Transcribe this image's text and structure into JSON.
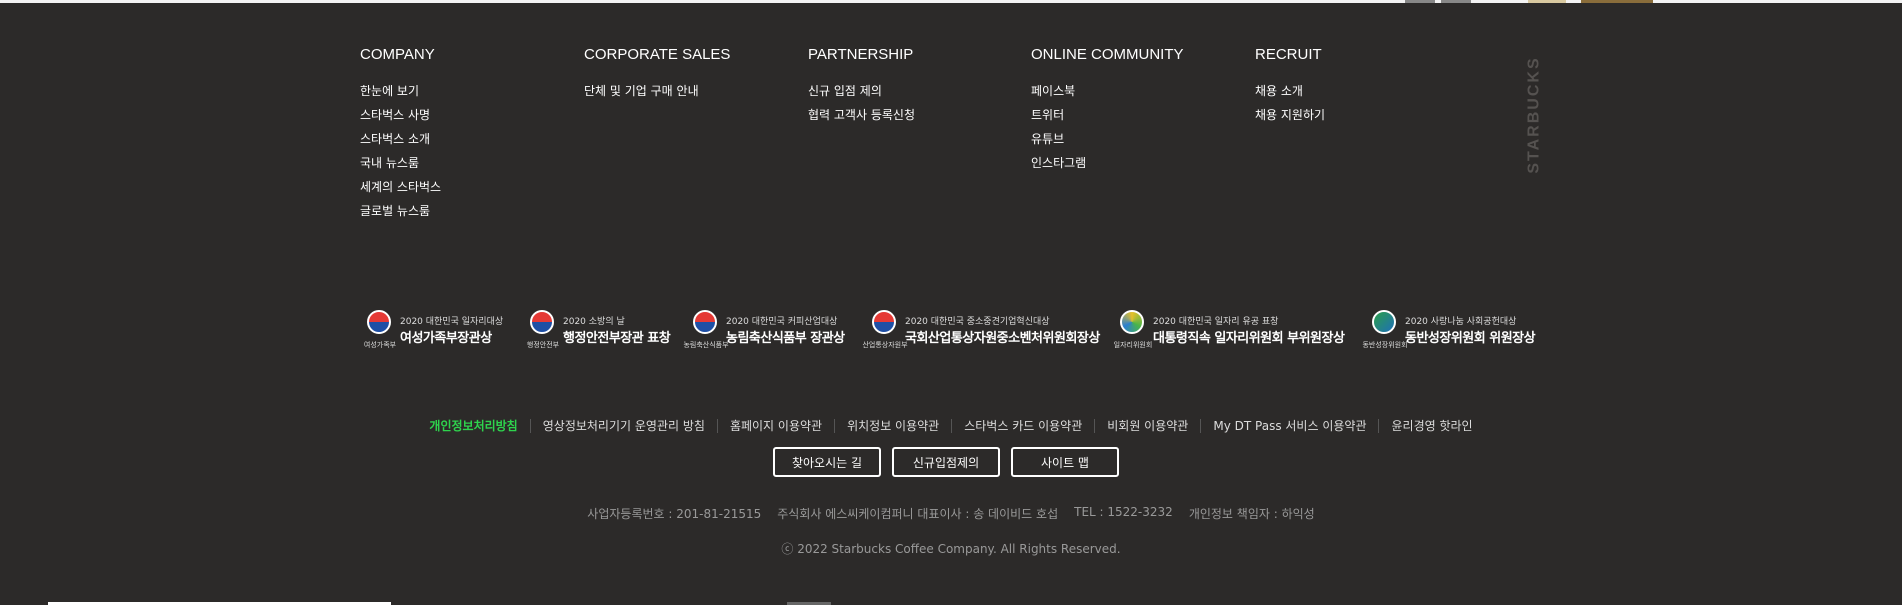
{
  "columns": [
    {
      "title": "COMPANY",
      "items": [
        "한눈에 보기",
        "스타벅스 사명",
        "스타벅스 소개",
        "국내 뉴스룸",
        "세계의 스타벅스",
        "글로벌 뉴스룸"
      ]
    },
    {
      "title": "CORPORATE SALES",
      "items": [
        "단체 및 기업 구매 안내"
      ]
    },
    {
      "title": "PARTNERSHIP",
      "items": [
        "신규 입점 제의",
        "협력 고객사 등록신청"
      ]
    },
    {
      "title": "ONLINE COMMUNITY",
      "items": [
        "페이스북",
        "트위터",
        "유튜브",
        "인스타그램"
      ]
    },
    {
      "title": "RECRUIT",
      "items": [
        "채용 소개",
        "채용 지원하기"
      ]
    }
  ],
  "brand_vertical": "STARBUCKS",
  "awards": [
    {
      "ministry": "여성가족부",
      "small": "2020 대한민국 일자리대상",
      "big": "여성가족부장관상"
    },
    {
      "ministry": "행정안전부",
      "small": "2020 소방의 날",
      "big": "행정안전부장관 표창"
    },
    {
      "ministry": "농림축산식품부",
      "small": "2020 대한민국 커피산업대상",
      "big": "농림축산식품부 장관상"
    },
    {
      "ministry": "산업통상자원부",
      "small": "2020 대한민국 중소중견기업혁신대상",
      "big": "국회산업통상자원중소벤처위원회장상"
    },
    {
      "ministry": "일자리위원회",
      "small": "2020 대한민국 일자리 유공 표창",
      "big": "대통령직속 일자리위원회 부위원장상"
    },
    {
      "ministry": "동반성장위원회",
      "small": "2020 사랑나눔 사회공헌대상",
      "big": "동반성장위원회 위원장상"
    }
  ],
  "policy_links": [
    "개인정보처리방침",
    "영상정보처리기기 운영관리 방침",
    "홈페이지 이용약관",
    "위치정보 이용약관",
    "스타벅스 카드 이용약관",
    "비회원 이용약관",
    "My DT Pass 서비스 이용약관",
    "윤리경영 핫라인"
  ],
  "buttons": [
    "찾아오시는 길",
    "신규입점제의",
    "사이트 맵"
  ],
  "company_info": [
    "사업자등록번호 : 201-81-21515",
    "주식회사 에스씨케이컴퍼니 대표이사 : 송 데이비드 호섭",
    "TEL : 1522-3232",
    "개인정보 책임자 : 하익성"
  ],
  "copyright": "ⓒ 2022 Starbucks Coffee Company. All Rights Reserved."
}
